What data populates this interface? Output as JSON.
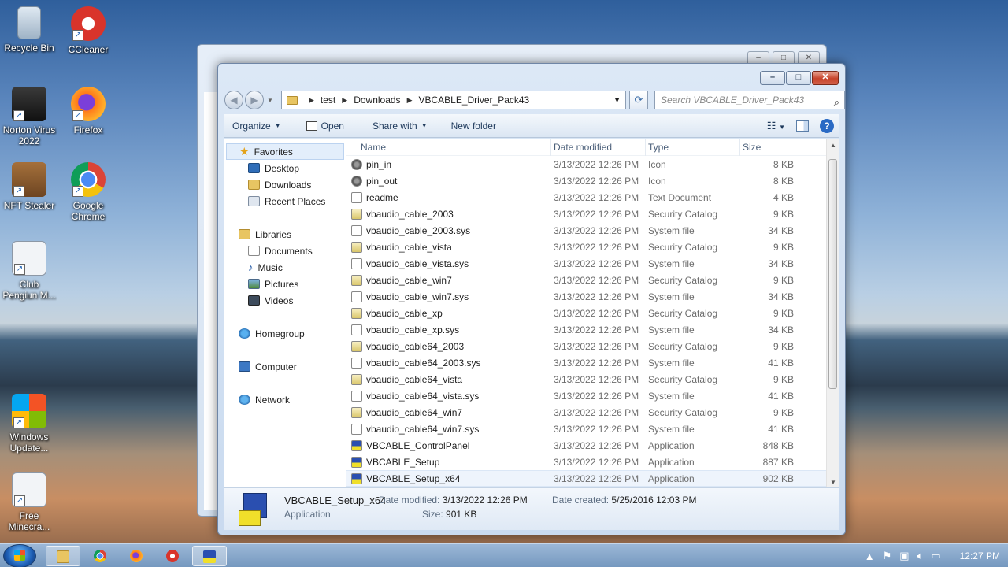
{
  "desktop": {
    "icons": [
      {
        "label": "Recycle Bin"
      },
      {
        "label": "CCleaner"
      },
      {
        "label": "Norton Virus 2022"
      },
      {
        "label": "Firefox"
      },
      {
        "label": "NFT Stealer"
      },
      {
        "label": "Google Chrome"
      },
      {
        "label": "Club Pengiun M..."
      },
      {
        "label": "Windows Update..."
      },
      {
        "label": "Free Minecra..."
      }
    ]
  },
  "window": {
    "caption_buttons": {
      "minimize": "–",
      "maximize": "□",
      "close": "✕"
    },
    "address": {
      "crumbs": [
        "test",
        "Downloads",
        "VBCABLE_Driver_Pack43"
      ]
    },
    "search": {
      "placeholder": "Search VBCABLE_Driver_Pack43"
    },
    "toolbar": {
      "organize": "Organize",
      "open": "Open",
      "share_with": "Share with",
      "new_folder": "New folder"
    },
    "nav": {
      "favorites": "Favorites",
      "desktop": "Desktop",
      "downloads": "Downloads",
      "recent_places": "Recent Places",
      "libraries": "Libraries",
      "documents": "Documents",
      "music": "Music",
      "pictures": "Pictures",
      "videos": "Videos",
      "homegroup": "Homegroup",
      "computer": "Computer",
      "network": "Network"
    },
    "columns": {
      "name": "Name",
      "date": "Date modified",
      "type": "Type",
      "size": "Size"
    },
    "files": [
      {
        "name": "pin_in",
        "date": "3/13/2022 12:26 PM",
        "type": "Icon",
        "size": "8 KB"
      },
      {
        "name": "pin_out",
        "date": "3/13/2022 12:26 PM",
        "type": "Icon",
        "size": "8 KB"
      },
      {
        "name": "readme",
        "date": "3/13/2022 12:26 PM",
        "type": "Text Document",
        "size": "4 KB"
      },
      {
        "name": "vbaudio_cable_2003",
        "date": "3/13/2022 12:26 PM",
        "type": "Security Catalog",
        "size": "9 KB"
      },
      {
        "name": "vbaudio_cable_2003.sys",
        "date": "3/13/2022 12:26 PM",
        "type": "System file",
        "size": "34 KB"
      },
      {
        "name": "vbaudio_cable_vista",
        "date": "3/13/2022 12:26 PM",
        "type": "Security Catalog",
        "size": "9 KB"
      },
      {
        "name": "vbaudio_cable_vista.sys",
        "date": "3/13/2022 12:26 PM",
        "type": "System file",
        "size": "34 KB"
      },
      {
        "name": "vbaudio_cable_win7",
        "date": "3/13/2022 12:26 PM",
        "type": "Security Catalog",
        "size": "9 KB"
      },
      {
        "name": "vbaudio_cable_win7.sys",
        "date": "3/13/2022 12:26 PM",
        "type": "System file",
        "size": "34 KB"
      },
      {
        "name": "vbaudio_cable_xp",
        "date": "3/13/2022 12:26 PM",
        "type": "Security Catalog",
        "size": "9 KB"
      },
      {
        "name": "vbaudio_cable_xp.sys",
        "date": "3/13/2022 12:26 PM",
        "type": "System file",
        "size": "34 KB"
      },
      {
        "name": "vbaudio_cable64_2003",
        "date": "3/13/2022 12:26 PM",
        "type": "Security Catalog",
        "size": "9 KB"
      },
      {
        "name": "vbaudio_cable64_2003.sys",
        "date": "3/13/2022 12:26 PM",
        "type": "System file",
        "size": "41 KB"
      },
      {
        "name": "vbaudio_cable64_vista",
        "date": "3/13/2022 12:26 PM",
        "type": "Security Catalog",
        "size": "9 KB"
      },
      {
        "name": "vbaudio_cable64_vista.sys",
        "date": "3/13/2022 12:26 PM",
        "type": "System file",
        "size": "41 KB"
      },
      {
        "name": "vbaudio_cable64_win7",
        "date": "3/13/2022 12:26 PM",
        "type": "Security Catalog",
        "size": "9 KB"
      },
      {
        "name": "vbaudio_cable64_win7.sys",
        "date": "3/13/2022 12:26 PM",
        "type": "System file",
        "size": "41 KB"
      },
      {
        "name": "VBCABLE_ControlPanel",
        "date": "3/13/2022 12:26 PM",
        "type": "Application",
        "size": "848 KB"
      },
      {
        "name": "VBCABLE_Setup",
        "date": "3/13/2022 12:26 PM",
        "type": "Application",
        "size": "887 KB"
      },
      {
        "name": "VBCABLE_Setup_x64",
        "date": "3/13/2022 12:26 PM",
        "type": "Application",
        "size": "902 KB"
      }
    ],
    "details": {
      "name": "VBCABLE_Setup_x64",
      "kind": "Application",
      "modified_label": "Date modified:",
      "modified_value": "3/13/2022 12:26 PM",
      "created_label": "Date created:",
      "created_value": "5/25/2016 12:03 PM",
      "size_label": "Size:",
      "size_value": "901 KB"
    }
  },
  "taskbar": {
    "clock": "12:27 PM"
  }
}
